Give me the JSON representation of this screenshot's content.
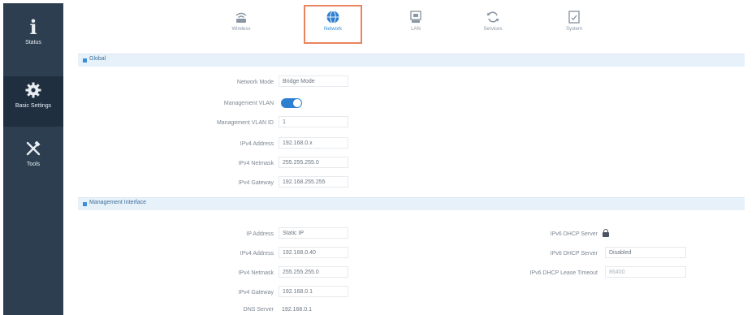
{
  "sidebar": {
    "items": [
      {
        "label": "Status",
        "icon": "info-icon",
        "glyph": "i"
      },
      {
        "label": "Basic Settings",
        "icon": "gear-icon",
        "glyph": "⚙"
      },
      {
        "label": "Tools",
        "icon": "tools-icon",
        "glyph": "⚒"
      }
    ]
  },
  "topnav": {
    "tabs": [
      {
        "label": "Wireless",
        "icon": "wireless-icon"
      },
      {
        "label": "Network",
        "icon": "globe-icon",
        "active": true
      },
      {
        "label": "LAN",
        "icon": "lan-icon"
      },
      {
        "label": "Services",
        "icon": "refresh-icon"
      },
      {
        "label": "System",
        "icon": "system-icon"
      }
    ]
  },
  "global": {
    "title": "Global",
    "rows": [
      {
        "label": "Network Mode",
        "value": "Bridge Mode"
      },
      {
        "label": "Management VLAN",
        "value": ""
      },
      {
        "label": "Management VLAN ID",
        "value": "1"
      },
      {
        "label": "IPv4 Address",
        "value": "192.168.0.x"
      },
      {
        "label": "IPv4 Netmask",
        "value": "255.255.255.0"
      },
      {
        "label": "IPv4 Gateway",
        "value": "192.168.255.255"
      }
    ]
  },
  "management": {
    "title": "Management Interface",
    "left_rows": [
      {
        "label": "IP Address",
        "value": "Static IP"
      },
      {
        "label": "IPv4 Address",
        "value": "192.168.0.40"
      },
      {
        "label": "IPv4 Netmask",
        "value": "255.255.255.0"
      },
      {
        "label": "IPv4 Gateway",
        "value": "192.168.0.1"
      },
      {
        "label": "DNS Server",
        "value": "192.168.0.1"
      }
    ],
    "right_rows": [
      {
        "label": "IPv6 DHCP Server",
        "value": ""
      },
      {
        "label": "IPv6 DHCP Server",
        "value": "Disabled"
      },
      {
        "label": "IPv6 DHCP Lease Timeout",
        "value": "86400"
      }
    ]
  },
  "colors": {
    "sidebar_bg": "#2c3e50",
    "accent": "#2f7fd1",
    "active_tab_border": "#e8845e",
    "section_bg": "#e6f1fa"
  }
}
